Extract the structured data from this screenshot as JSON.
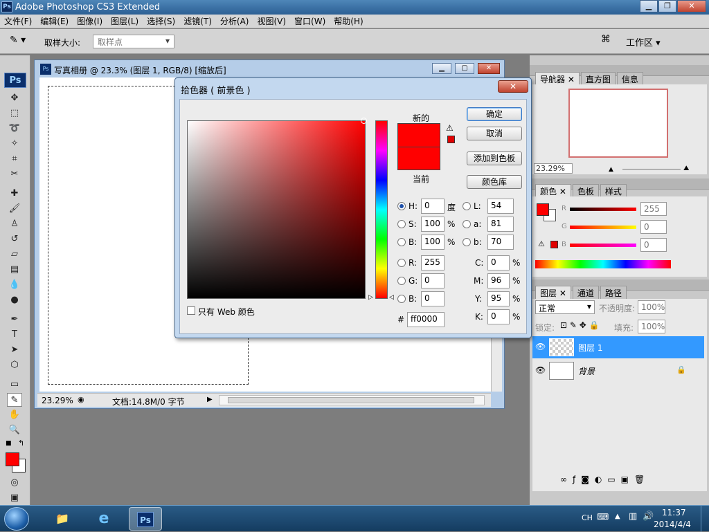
{
  "app": {
    "title": "Adobe Photoshop CS3 Extended"
  },
  "menubar": [
    "文件(F)",
    "编辑(E)",
    "图像(I)",
    "图层(L)",
    "选择(S)",
    "滤镜(T)",
    "分析(A)",
    "视图(V)",
    "窗口(W)",
    "帮助(H)"
  ],
  "options": {
    "sample_size_label": "取样大小:",
    "sample_value": "取样点",
    "workspace_label": "工作区"
  },
  "document": {
    "title": "写真相册 @ 23.3% (图层 1, RGB/8) [缩放后]",
    "zoom": "23.29%",
    "doc_info": "文档:14.8M/0 字节"
  },
  "navigator": {
    "tabs": [
      "导航器",
      "直方图",
      "信息"
    ],
    "zoom": "23.29%"
  },
  "color_panel": {
    "tabs": [
      "颜色",
      "色板",
      "样式"
    ],
    "R": "255",
    "G": "0",
    "B": "0",
    "r_label": "R",
    "g_label": "G",
    "b_label": "B"
  },
  "layers_panel": {
    "tabs": [
      "图层",
      "通道",
      "路径"
    ],
    "blend_mode": "正常",
    "opacity_label": "不透明度:",
    "opacity": "100%",
    "lock_label": "锁定:",
    "fill_label": "填充:",
    "fill": "100%",
    "layers": [
      {
        "name": "图层 1"
      },
      {
        "name": "背景"
      }
    ]
  },
  "color_picker": {
    "title": "拾色器 ( 前景色 )",
    "new_label": "新的",
    "current_label": "当前",
    "ok": "确定",
    "cancel": "取消",
    "add_swatches": "添加到色板",
    "color_libraries": "颜色库",
    "web_only": "只有 Web 颜色",
    "H": "0",
    "S": "100",
    "B": "100",
    "R": "255",
    "G": "0",
    "Bv": "0",
    "L": "54",
    "a": "81",
    "b": "70",
    "C": "0",
    "M": "96",
    "Y": "95",
    "K": "0",
    "hex": "ff0000",
    "h_label": "H:",
    "s_label": "S:",
    "b_label": "B:",
    "r_label": "R:",
    "g_label": "G:",
    "bb_label": "B:",
    "l_label": "L:",
    "a_label": "a:",
    "b2_label": "b:",
    "c_label": "C:",
    "m_label": "M:",
    "y_label": "Y:",
    "k_label": "K:",
    "deg": "度",
    "pct": "%",
    "hash": "#"
  },
  "taskbar": {
    "lang": "CH",
    "time": "11:37",
    "date": "2014/4/4"
  },
  "colors": {
    "accent": "#3a78c5",
    "foreground": "#ff0000"
  }
}
